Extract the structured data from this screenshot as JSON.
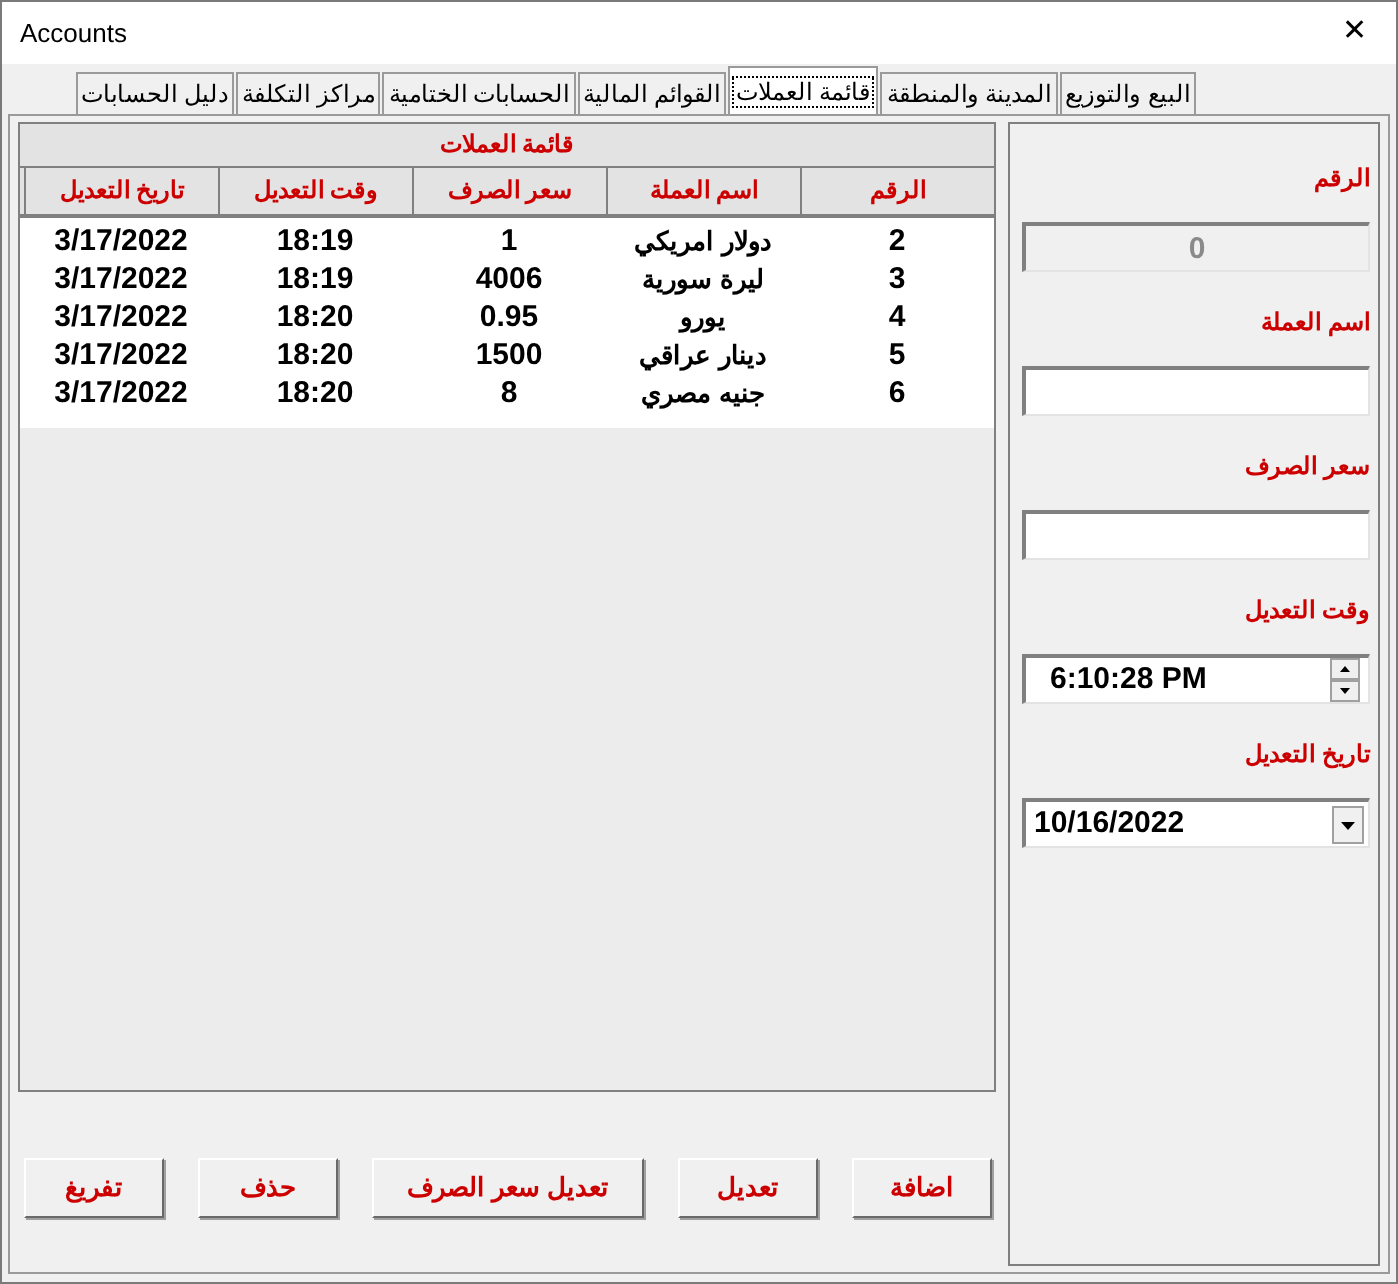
{
  "window": {
    "title": "Accounts",
    "close": "✕"
  },
  "tabs": [
    {
      "label": "البيع والتوزيع",
      "selected": false
    },
    {
      "label": "المدينة والمنطقة",
      "selected": false
    },
    {
      "label": "قائمة العملات",
      "selected": true
    },
    {
      "label": "القوائم المالية",
      "selected": false
    },
    {
      "label": "الحسابات الختامية",
      "selected": false
    },
    {
      "label": "مراكز التكلفة",
      "selected": false
    },
    {
      "label": "دليل الحسابات",
      "selected": false
    }
  ],
  "table": {
    "title": "قائمة العملات",
    "columns": [
      "الرقم",
      "اسم العملة",
      "سعر الصرف",
      "وقت التعديل",
      "تاريخ التعديل"
    ],
    "rows": [
      [
        "2",
        "دولار امريكي",
        "1",
        "18:19",
        "3/17/2022"
      ],
      [
        "3",
        "ليرة سورية",
        "4006",
        "18:19",
        "3/17/2022"
      ],
      [
        "4",
        "يورو",
        "0.95",
        "18:20",
        "3/17/2022"
      ],
      [
        "5",
        "دينار عراقي",
        "1500",
        "18:20",
        "3/17/2022"
      ],
      [
        "6",
        "جنيه مصري",
        "8",
        "18:20",
        "3/17/2022"
      ]
    ]
  },
  "form": [
    {
      "label": "الرقم",
      "kind": "text",
      "value": "0",
      "disabled": true
    },
    {
      "label": "اسم العملة",
      "kind": "text",
      "disabled": false
    },
    {
      "label": "سعر الصرف",
      "kind": "text",
      "disabled": false
    },
    {
      "label": "وقت التعديل",
      "kind": "spin",
      "value": "6:10:28 PM",
      "disabled": false
    },
    {
      "label": "تاريخ التعديل",
      "kind": "date",
      "value": "10/16/2022",
      "disabled": false
    }
  ],
  "buttons": [
    "اضافة",
    "تعديل",
    "تعديل سعر الصرف",
    "حذف",
    "تفريغ"
  ]
}
